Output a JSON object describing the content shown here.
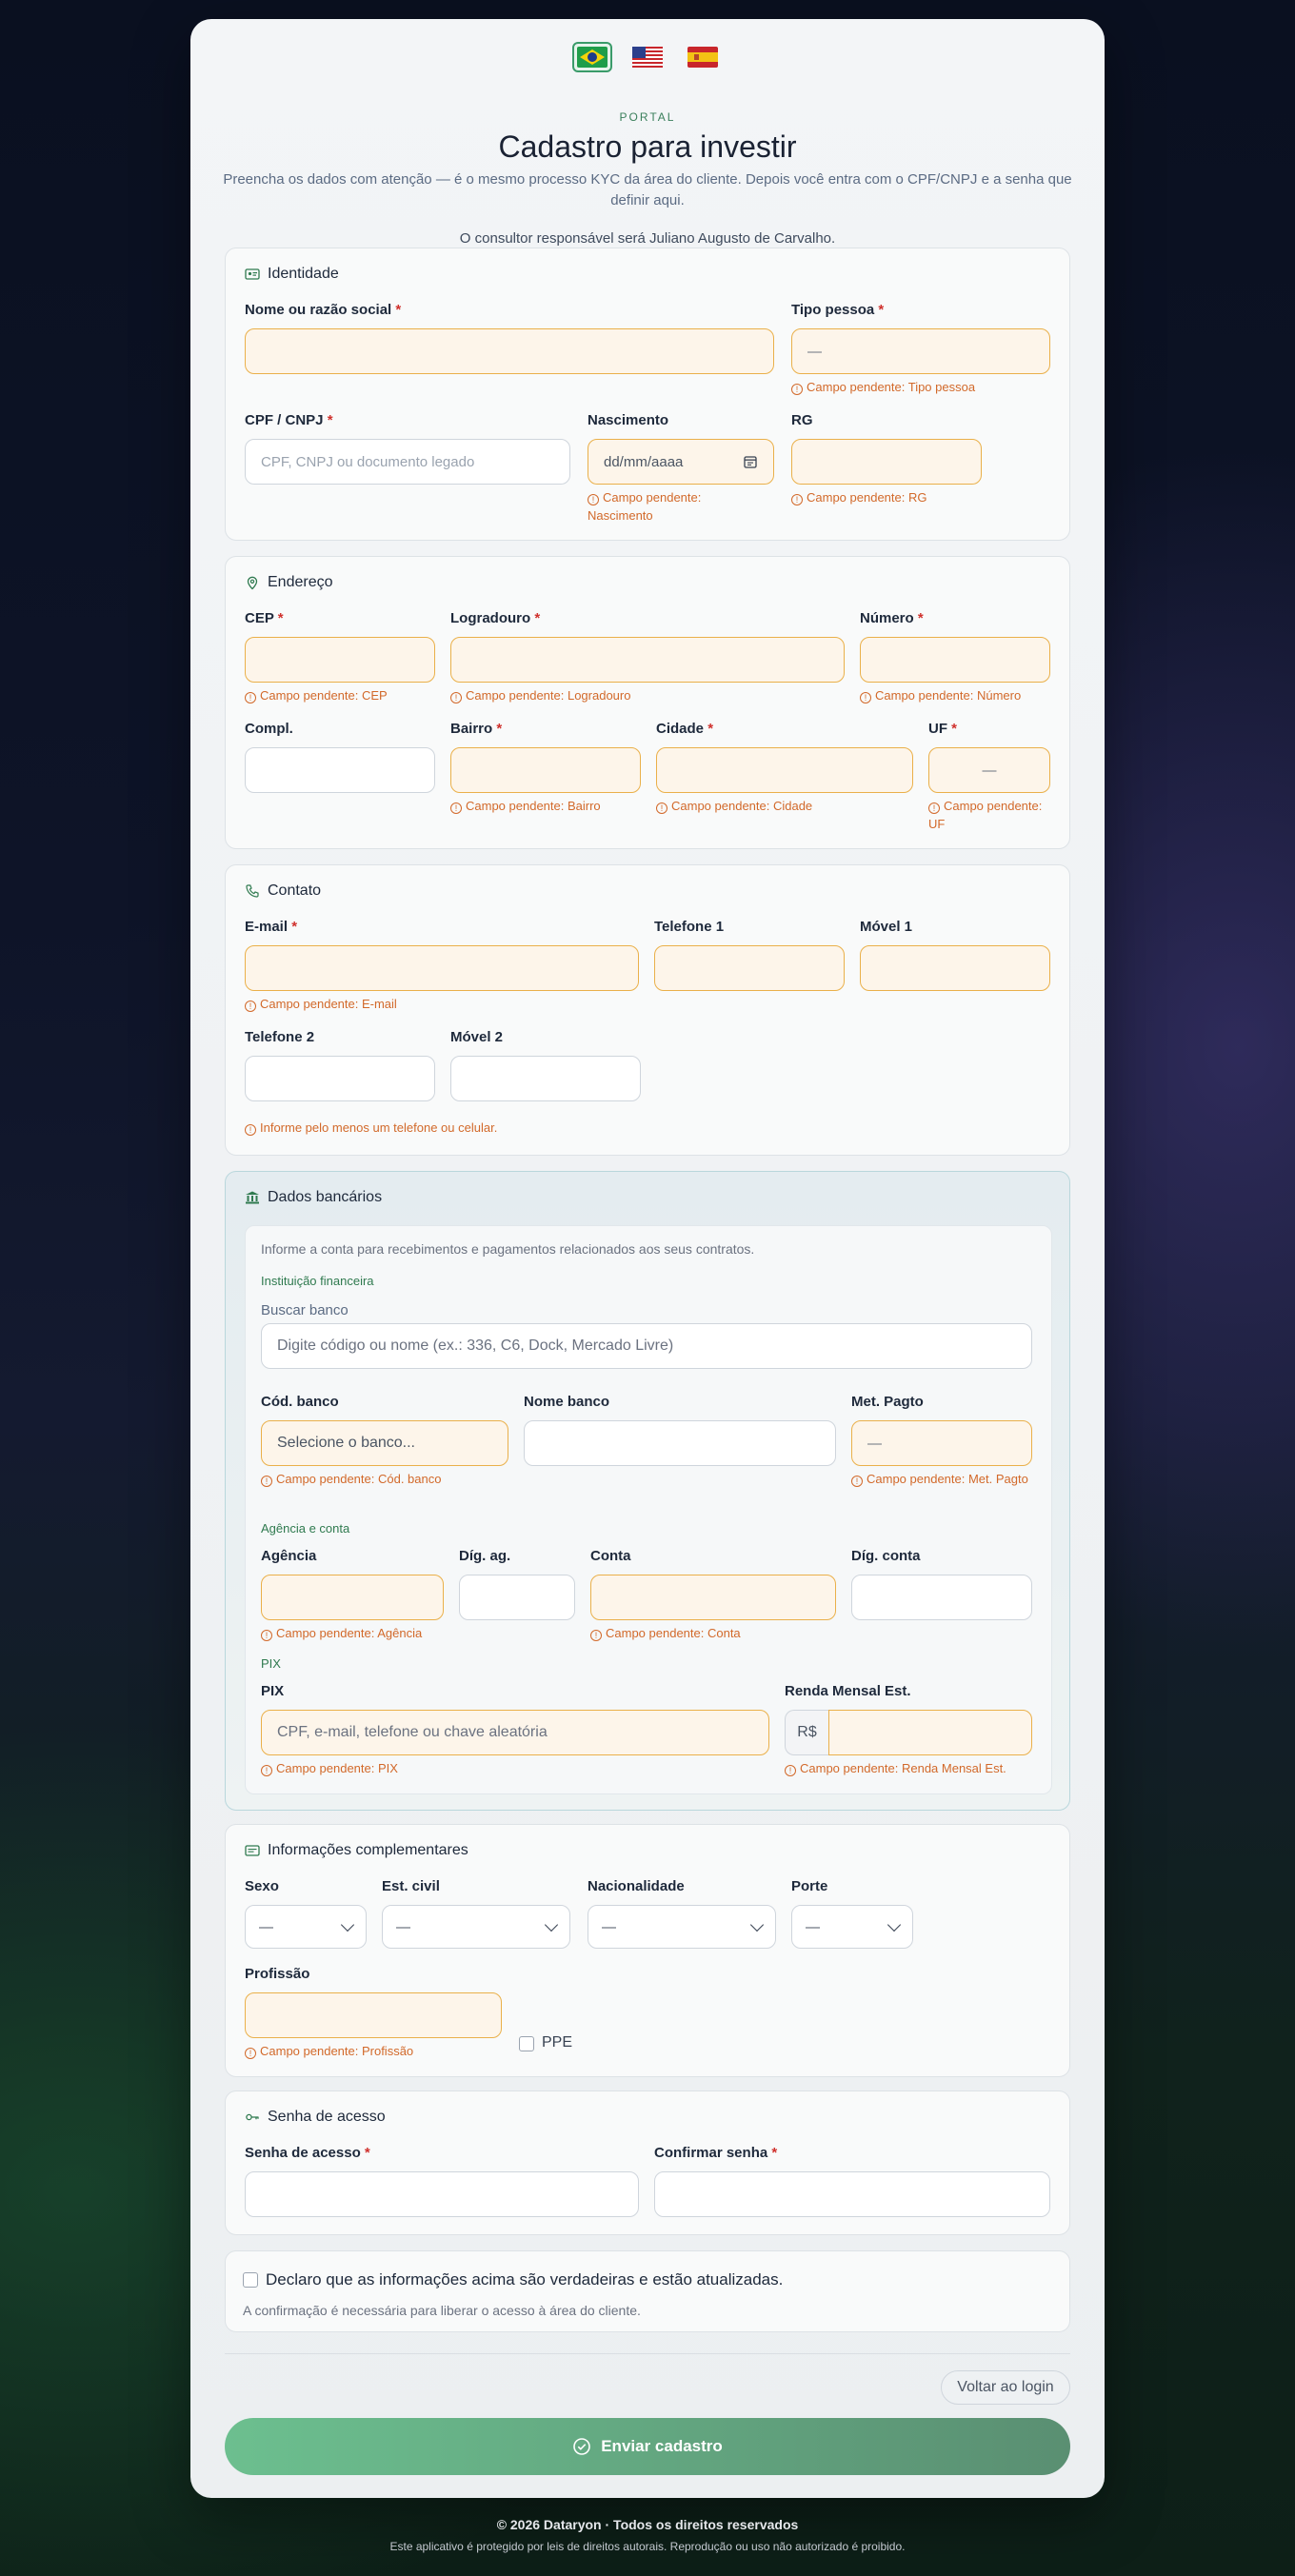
{
  "header": {
    "flags": [
      "Brasil flag",
      "USA flag",
      "Spain flag"
    ],
    "eyebrow": "PORTAL",
    "title": "Cadastro para investir",
    "subtitle": "Preencha os dados com atenção — é o mesmo processo KYC da área do cliente. Depois você entra com o CPF/CNPJ e a senha que definir aqui.",
    "consultant": "O consultor responsável será Juliano Augusto de Carvalho."
  },
  "identidade": {
    "title": "Identidade",
    "nome_label": "Nome ou razão social",
    "tipo_label": "Tipo pessoa",
    "tipo_value": "—",
    "tipo_error": "Campo pendente: Tipo pessoa",
    "cpf_label": "CPF / CNPJ",
    "cpf_placeholder": "CPF, CNPJ ou documento legado",
    "nasc_label": "Nascimento",
    "nasc_placeholder": "dd/mm/aaaa",
    "nasc_error": "Campo pendente: Nascimento",
    "rg_label": "RG",
    "rg_error": "Campo pendente: RG"
  },
  "endereco": {
    "title": "Endereço",
    "cep_label": "CEP",
    "cep_error": "Campo pendente: CEP",
    "logradouro_label": "Logradouro",
    "logradouro_error": "Campo pendente: Logradouro",
    "numero_label": "Número",
    "numero_error": "Campo pendente: Número",
    "compl_label": "Compl.",
    "bairro_label": "Bairro",
    "bairro_error": "Campo pendente: Bairro",
    "cidade_label": "Cidade",
    "cidade_error": "Campo pendente: Cidade",
    "uf_label": "UF",
    "uf_value": "—",
    "uf_error": "Campo pendente: UF"
  },
  "contato": {
    "title": "Contato",
    "email_label": "E-mail",
    "email_error": "Campo pendente: E-mail",
    "tel1_label": "Telefone 1",
    "movel1_label": "Móvel 1",
    "tel2_label": "Telefone 2",
    "movel2_label": "Móvel 2",
    "phone_error": "Informe pelo menos um telefone ou celular."
  },
  "banco": {
    "title": "Dados bancários",
    "intro": "Informe a conta para recebimentos e pagamentos relacionados aos seus contratos.",
    "inst_heading": "Instituição financeira",
    "buscar_label": "Buscar banco",
    "buscar_placeholder": "Digite código ou nome (ex.: 336, C6, Dock, Mercado Livre)",
    "cod_label": "Cód. banco",
    "cod_value": "Selecione o banco...",
    "cod_error": "Campo pendente: Cód. banco",
    "nome_label": "Nome banco",
    "met_label": "Met. Pagto",
    "met_value": "—",
    "met_error": "Campo pendente: Met. Pagto",
    "ag_heading": "Agência e conta",
    "agencia_label": "Agência",
    "agencia_error": "Campo pendente: Agência",
    "dig_ag_label": "Díg. ag.",
    "conta_label": "Conta",
    "conta_error": "Campo pendente: Conta",
    "dig_conta_label": "Díg. conta",
    "pix_heading": "PIX",
    "pix_label": "PIX",
    "pix_placeholder": "CPF, e-mail, telefone ou chave aleatória",
    "pix_error": "Campo pendente: PIX",
    "renda_label": "Renda Mensal Est.",
    "renda_prefix": "R$",
    "renda_error": "Campo pendente: Renda Mensal Est."
  },
  "complementares": {
    "title": "Informações complementares",
    "sexo_label": "Sexo",
    "sexo_value": "—",
    "civil_label": "Est. civil",
    "civil_value": "—",
    "nac_label": "Nacionalidade",
    "nac_value": "—",
    "porte_label": "Porte",
    "porte_value": "—",
    "prof_label": "Profissão",
    "prof_error": "Campo pendente: Profissão",
    "ppe_label": "PPE"
  },
  "senha": {
    "title": "Senha de acesso",
    "senha_label": "Senha de acesso",
    "confirmar_label": "Confirmar senha"
  },
  "declaracao": {
    "label": "Declaro que as informações acima são verdadeiras e estão atualizadas.",
    "hint": "A confirmação é necessária para liberar o acesso à área do cliente."
  },
  "actions": {
    "back": "Voltar ao login",
    "submit": "Enviar cadastro"
  },
  "footer": {
    "copyright": "© 2026 Dataryon · Todos os direitos reservados",
    "notice": "Este aplicativo é protegido por leis de direitos autorais. Reprodução ou uso não autorizado é proibido."
  },
  "colors": {
    "accent": "#3a9b6a",
    "pending_border": "#eab04a",
    "pending_bg": "#fdf5ea",
    "error": "#d2692a",
    "required": "#d0312d"
  }
}
